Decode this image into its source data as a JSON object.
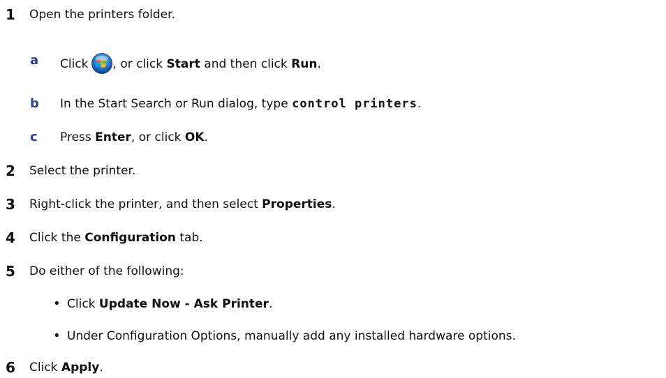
{
  "steps": {
    "s1": {
      "num": "1",
      "text": "Open the printers folder."
    },
    "s1a": {
      "letter": "a",
      "pre": "Click",
      "mid": ", or click",
      "start": "Start",
      "and": "and then click",
      "run": "Run",
      "end": "."
    },
    "s1b": {
      "letter": "b",
      "pre": "In the Start Search or Run dialog, type",
      "cmd": "control printers",
      "end": "."
    },
    "s1c": {
      "letter": "c",
      "pre": "Press",
      "enter": "Enter",
      "mid": ", or click",
      "ok": "OK",
      "end": "."
    },
    "s2": {
      "num": "2",
      "text": "Select the printer."
    },
    "s3": {
      "num": "3",
      "pre": "Right-click the printer, and then select",
      "bold": "Properties",
      "end": "."
    },
    "s4": {
      "num": "4",
      "pre": "Click the",
      "bold": "Configuration",
      "post": "tab."
    },
    "s5": {
      "num": "5",
      "text": "Do either of the following:"
    },
    "s5b1": {
      "pre": "Click",
      "bold": "Update Now - Ask Printer",
      "end": "."
    },
    "s5b2": {
      "text": "Under Configuration Options, manually add any installed hardware options."
    },
    "s6": {
      "num": "6",
      "pre": "Click",
      "bold": "Apply",
      "end": "."
    }
  },
  "bullet_char": "•",
  "icons": {
    "start_button": "windows-start-orb-icon"
  }
}
